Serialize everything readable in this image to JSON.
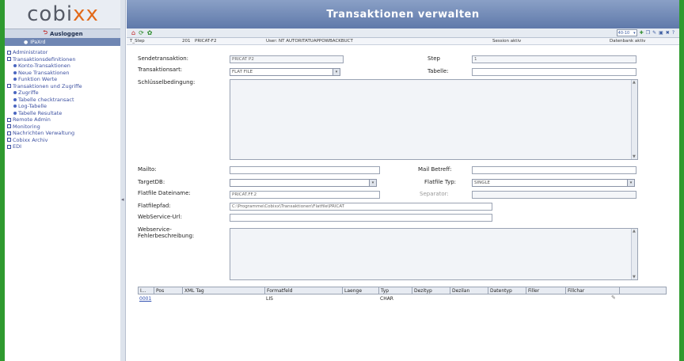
{
  "sidebar": {
    "logo_a": "cobi",
    "logo_b": "xx",
    "logout_label": "Ausloggen",
    "user_label": "IPaXrd",
    "tree": [
      {
        "label": "Administrator",
        "level": 0
      },
      {
        "label": "Transaktionsdefinitionen",
        "level": 0
      },
      {
        "label": "Konto-Transaktionen",
        "level": 1
      },
      {
        "label": "Neue Transaktionen",
        "level": 1
      },
      {
        "label": "Funktion Werte",
        "level": 1
      },
      {
        "label": "Transaktionen und Zugriffe",
        "level": 0
      },
      {
        "label": "Zugriffe",
        "level": 1
      },
      {
        "label": "Tabelle checktransact",
        "level": 1
      },
      {
        "label": "Log-Tabelle",
        "level": 1
      },
      {
        "label": "Tabelle Resultate",
        "level": 1
      },
      {
        "label": "Remote Admin",
        "level": 0
      },
      {
        "label": "Monitoring",
        "level": 0
      },
      {
        "label": "Nachrichten Verwaltung",
        "level": 0
      },
      {
        "label": "Cobixx Archiv",
        "level": 0
      },
      {
        "label": "EDI",
        "level": 0
      }
    ]
  },
  "header": {
    "title": "Transaktionen verwalten",
    "toolbar_select": "40-10",
    "status_left": "T_Step",
    "status_id": "201",
    "status_code": "PRICAT-F2",
    "status_user": "User: NT AUTORITATUAPPOWBACKBUCT",
    "status_session": "Session aktiv",
    "status_right": "Datenbank aktiv"
  },
  "form": {
    "send_label": "Sendetransaktion:",
    "send_value": "PRICAT P2",
    "step_label": "Step",
    "step_value": "1",
    "type_label": "Transaktionsart:",
    "type_value": "FLAT FILE",
    "table_label": "Tabelle:",
    "table_value": "",
    "key_label": "Schlüsselbedingung:",
    "mailto_label": "Mailto:",
    "mailto_value": "",
    "mailbetreff_label": "Mail Betreff:",
    "mailbetreff_value": "",
    "targetdb_label": "TargetDB:",
    "targetdb_value": "",
    "filetype_label": "Flatfile Typ:",
    "filetype_value": "SINGLE",
    "filename_label": "Flatfile Dateiname:",
    "filename_value": "PRICAT.FF.2",
    "separator_label": "Separator:",
    "separator_value": "",
    "path_label": "Flatfilepfad:",
    "path_value": "C:\\Programme\\Cobixx\\Transaktionen\\Flatfile\\PRICAT",
    "webservice_url_label": "WebService-Url:",
    "webservice_url_value": "",
    "webservice_desc_label": "Webservice-Fehlerbeschreibung:"
  },
  "grid": {
    "columns": [
      "I...",
      "Pos",
      "XML Tag",
      "Formatfeld",
      "Laenge",
      "Typ",
      "Dezityp",
      "Dezilan",
      "Datentyp",
      "Filler",
      "Fillchar"
    ],
    "rows": [
      {
        "i": "0001",
        "pos": "",
        "xml": "",
        "feld": "LIS",
        "laenge": "",
        "typ": "CHAR",
        "dezi": "",
        "dezilan": "",
        "datentyp": "",
        "filler": "",
        "fillchar": ""
      }
    ]
  }
}
